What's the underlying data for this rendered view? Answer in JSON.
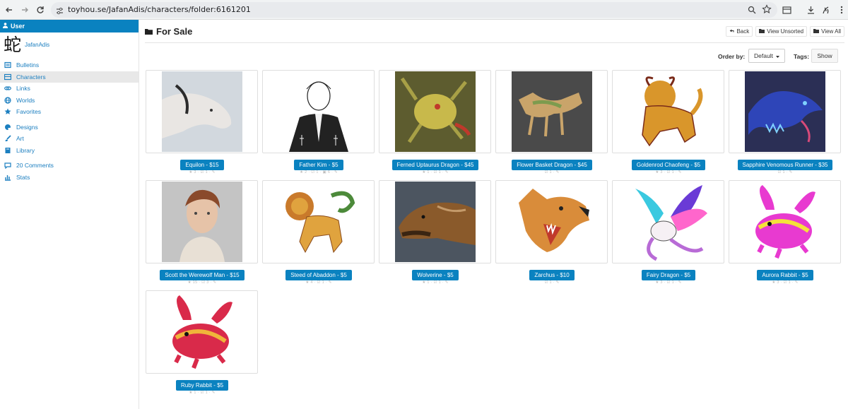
{
  "browser": {
    "url": "toyhou.se/JafanAdis/characters/folder:6161201"
  },
  "sidebar": {
    "header": "User",
    "username": "JafanAdis",
    "avatar_glyph": "蛇",
    "items": [
      {
        "label": "Bulletins",
        "icon": "bulletin-icon"
      },
      {
        "label": "Characters",
        "icon": "characters-icon",
        "active": true
      },
      {
        "label": "Links",
        "icon": "link-icon"
      },
      {
        "label": "Worlds",
        "icon": "globe-icon"
      },
      {
        "label": "Favorites",
        "icon": "star-icon"
      },
      {
        "label": "Designs",
        "icon": "palette-icon"
      },
      {
        "label": "Art",
        "icon": "brush-icon"
      },
      {
        "label": "Library",
        "icon": "book-icon"
      },
      {
        "label": "20 Comments",
        "icon": "comments-icon"
      },
      {
        "label": "Stats",
        "icon": "stats-icon"
      }
    ]
  },
  "main": {
    "title": "For Sale",
    "buttons": {
      "back": "Back",
      "view_unsorted": "View Unsorted",
      "view_all": "View All"
    },
    "order_by_label": "Order by:",
    "order_by_value": "Default",
    "tags_label": "Tags:",
    "tags_button": "Show"
  },
  "characters": [
    {
      "label": "Equilon - $15",
      "stats": "★ 3 · ☑ 1 · ✎",
      "bg": "#d2d8de",
      "fg": "#e9e6e3",
      "accent": "#2b2b2b"
    },
    {
      "label": "Father Kim - $5",
      "stats": "★ 2 · ☑ 1 · ▣ 6 · ✎",
      "bg": "#ffffff",
      "fg": "#222222",
      "accent": "#f2f2f2"
    },
    {
      "label": "Ferned Uptaurus Dragon - $45",
      "stats": "★ 1 · ☑ 1 · ✎",
      "bg": "#5d5c2f",
      "fg": "#c8b94b",
      "accent": "#c0392b"
    },
    {
      "label": "Flower Basket Dragon - $45",
      "stats": "☑ 1 · ✎",
      "bg": "#4a4a4a",
      "fg": "#c9a46a",
      "accent": "#7d9b4e"
    },
    {
      "label": "Goldenrod Chaofeng - $5",
      "stats": "★ 3 · ☑ 1 · ✎",
      "bg": "#ffffff",
      "fg": "#d9962b",
      "accent": "#7a2b1a"
    },
    {
      "label": "Sapphire Venomous Runner - $35",
      "stats": "☑ 1 · ✎",
      "bg": "#2b2f55",
      "fg": "#2e45b8",
      "accent": "#7fd1ff"
    },
    {
      "label": "Scott the Werewolf Man - $15",
      "stats": "★ 15 · ☑ 3 · ✎",
      "bg": "#c4c4c4",
      "fg": "#e6c3a8",
      "accent": "#8a4a2b"
    },
    {
      "label": "Steed of Abaddon - $5",
      "stats": "★ 4 · ☑ 1 · ✎",
      "bg": "#ffffff",
      "fg": "#e0a33e",
      "accent": "#4c8a3a"
    },
    {
      "label": "Wolverine - $5",
      "stats": "★ 1 · ☑ 1 · ✎",
      "bg": "#4c5560",
      "fg": "#8a5a2b",
      "accent": "#3a2512"
    },
    {
      "label": "Zarchus - $10",
      "stats": "☑ 1 · ✎",
      "bg": "#ffffff",
      "fg": "#d98c3a",
      "accent": "#c0392b"
    },
    {
      "label": "Fairy Dragon - $5",
      "stats": "★ 3 · ☑ 1 · ✎",
      "bg": "#ffffff",
      "fg": "#b86bd6",
      "accent": "#3ac9e0"
    },
    {
      "label": "Aurora Rabbit - $5",
      "stats": "★ 3 · ☑ 1 · ✎",
      "bg": "#ffffff",
      "fg": "#e83ad0",
      "accent": "#f4e23a"
    },
    {
      "label": "Ruby Rabbit - $5",
      "stats": "★ 1 · ☑ 1 · ✎",
      "bg": "#ffffff",
      "fg": "#d92a4a",
      "accent": "#f0b43a"
    }
  ]
}
